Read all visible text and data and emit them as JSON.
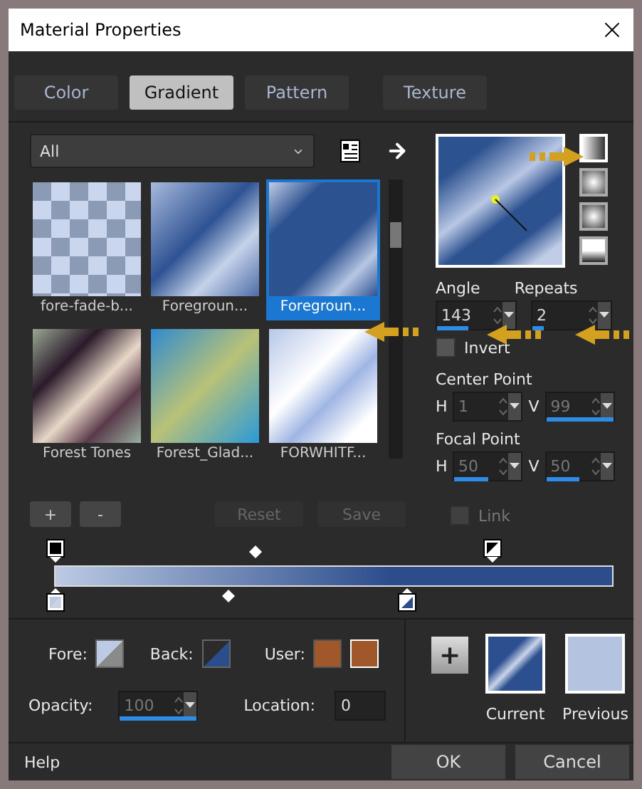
{
  "window": {
    "title": "Material Properties"
  },
  "tabs": [
    {
      "label": "Color",
      "selected": false
    },
    {
      "label": "Gradient",
      "selected": true
    },
    {
      "label": "Pattern",
      "selected": false
    },
    {
      "label": "Texture",
      "selected": false
    }
  ],
  "library": {
    "category": "All",
    "gradients": [
      {
        "name": "fore-fade-b...",
        "selected": false
      },
      {
        "name": "Foregroun...",
        "selected": false
      },
      {
        "name": "Foregroun...",
        "selected": true
      },
      {
        "name": "Forest Tones",
        "selected": false
      },
      {
        "name": "Forest_Glad...",
        "selected": false
      },
      {
        "name": "FORWHITF...",
        "selected": false
      }
    ]
  },
  "styles": [
    {
      "kind": "linear",
      "selected": true
    },
    {
      "kind": "rectangular",
      "selected": false
    },
    {
      "kind": "sunburst",
      "selected": false
    },
    {
      "kind": "radial",
      "selected": false
    }
  ],
  "angle": {
    "label": "Angle",
    "value": "143",
    "level": 0.4
  },
  "repeats": {
    "label": "Repeats",
    "value": "2",
    "level": 0.15
  },
  "invert": {
    "label": "Invert",
    "checked": false
  },
  "center_point": {
    "label": "Center Point",
    "disabled": true,
    "h": {
      "label": "H",
      "value": "1"
    },
    "v": {
      "label": "V",
      "value": "99",
      "level": 0.99
    }
  },
  "focal_point": {
    "label": "Focal Point",
    "disabled": true,
    "h": {
      "label": "H",
      "value": "50",
      "level": 0.5
    },
    "v": {
      "label": "V",
      "value": "50",
      "level": 0.5
    }
  },
  "link": {
    "label": "Link",
    "checked": false,
    "disabled": true
  },
  "stop_buttons": [
    "+",
    "-"
  ],
  "preset_buttons": [
    {
      "label": "Reset",
      "disabled": true
    },
    {
      "label": "Save",
      "disabled": true
    }
  ],
  "colors": {
    "fore_label": "Fore:",
    "back_label": "Back:",
    "user_label": "User:",
    "user": [
      {
        "color": "#a0582a"
      },
      {
        "color": "#a0582a"
      }
    ]
  },
  "opacity": {
    "label": "Opacity:",
    "value": "100",
    "level": 1,
    "disabled": true
  },
  "location": {
    "label": "Location:",
    "value": "0"
  },
  "add_button": "+",
  "swatches": [
    {
      "label": "Current",
      "kind": "gradient"
    },
    {
      "label": "Previous",
      "kind": "solid"
    }
  ],
  "footer": {
    "help": "Help",
    "buttons": [
      "OK",
      "Cancel"
    ]
  }
}
